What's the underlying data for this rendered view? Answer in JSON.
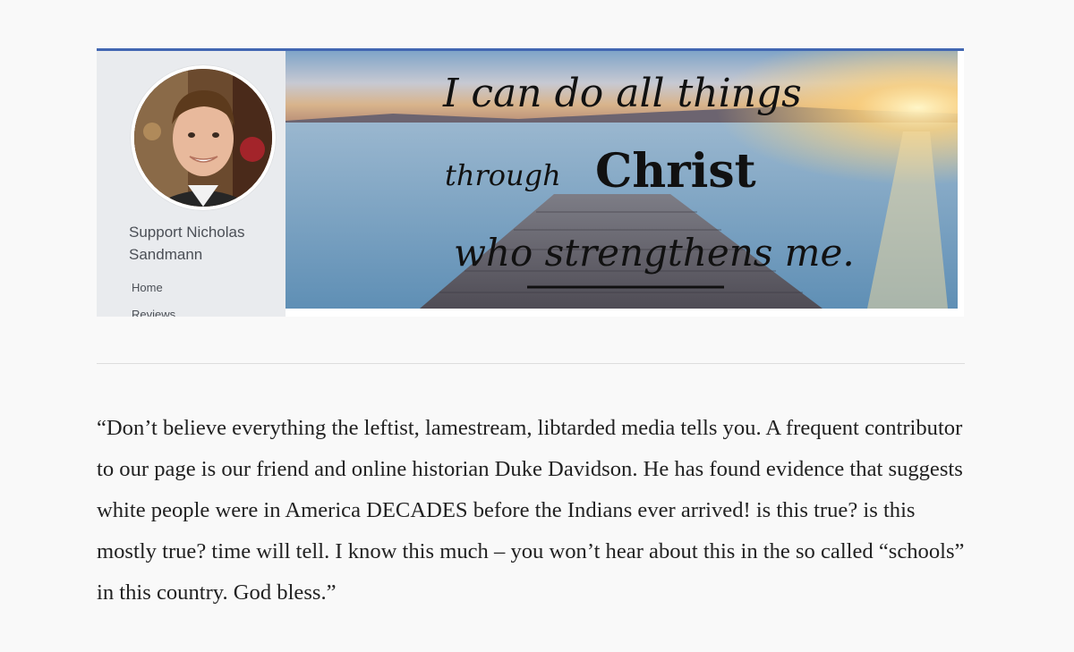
{
  "facebook_page": {
    "name": "Support Nicholas Sandmann",
    "nav": {
      "home": "Home",
      "reviews": "Reviews"
    },
    "cover_text": {
      "line1": "I can do all things",
      "line2_a": "through",
      "line2_b": "Christ",
      "line3": "who strengthens me."
    },
    "accent_color": "#4267b2",
    "sidebar_color": "#e9ebee"
  },
  "article": {
    "quote": "“Don’t believe everything the leftist, lamestream, libtarded media tells you. A frequent contributor to our page is our friend and online historian Duke Davidson. He has found evidence that suggests white people were in America DECADES before the Indians ever arrived! is this true? is this mostly true? time will tell. I know this much – you won’t hear about this in the so called “schools” in this country. God bless.”"
  }
}
